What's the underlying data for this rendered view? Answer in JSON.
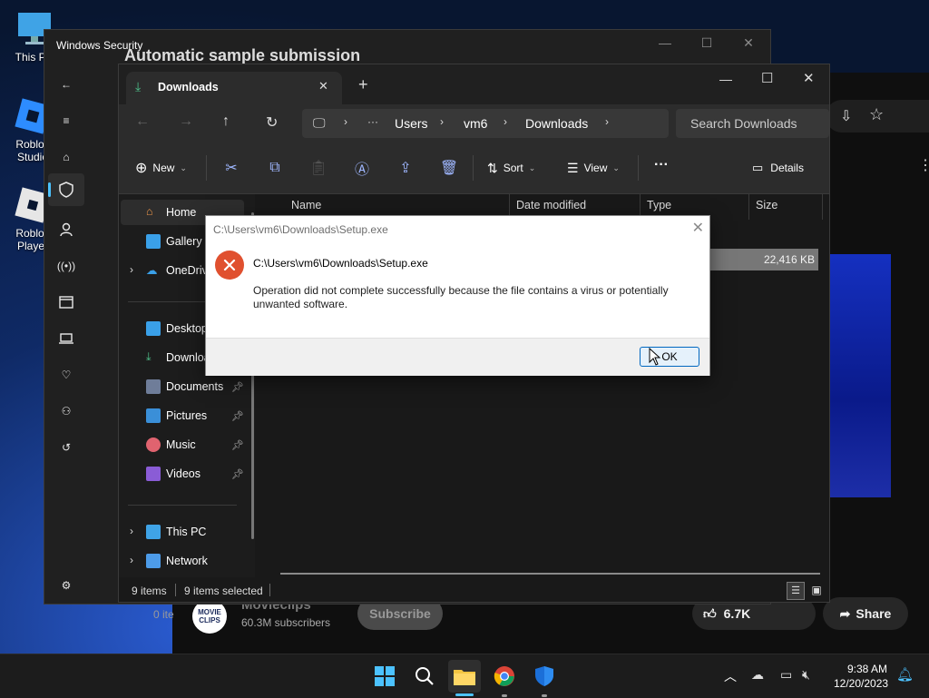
{
  "desktop": {
    "icons": [
      {
        "label": "This PC"
      },
      {
        "label": "Roblox Studio"
      },
      {
        "label": "Roblox Player"
      }
    ]
  },
  "background_browser": {
    "title_partial": "Automatic sample submission",
    "channel": "Movieclips",
    "subscribers": "60.3M subscribers",
    "subscribe_label": "Subscribe",
    "likes": "6.7K",
    "share_label": "Share",
    "items_partial": "0 ite"
  },
  "windows_security": {
    "title": "Windows Security",
    "controls": {
      "minimize": "—",
      "maximize": "☐",
      "close": "✕"
    }
  },
  "explorer": {
    "tab_label": "Downloads",
    "tab_close": "✕",
    "new_tab": "+",
    "window_controls": {
      "minimize": "—",
      "maximize": "☐",
      "close": "✕"
    },
    "breadcrumb": [
      "Users",
      "vm6",
      "Downloads"
    ],
    "breadcrumb_more": "···",
    "search_placeholder": "Search Downloads",
    "toolbar": {
      "new_label": "New",
      "sort_label": "Sort",
      "view_label": "View",
      "more_label": "···",
      "details_label": "Details"
    },
    "sidebar": {
      "home": "Home",
      "gallery": "Gallery",
      "onedrive": "OneDrive",
      "pinned": [
        "Desktop",
        "Downloads",
        "Documents",
        "Pictures",
        "Music",
        "Videos"
      ],
      "this_pc": "This PC",
      "network": "Network"
    },
    "columns": [
      "Name",
      "Date modified",
      "Type",
      "Size"
    ],
    "rows": [
      {
        "size": "22,416 KB"
      }
    ],
    "status": {
      "count": "9 items",
      "selected": "9 items selected"
    }
  },
  "dialog": {
    "title": "C:\\Users\\vm6\\Downloads\\Setup.exe",
    "heading": "C:\\Users\\vm6\\Downloads\\Setup.exe",
    "message": "Operation did not complete successfully because the file contains a virus or potentially unwanted software.",
    "ok_label": "OK",
    "close": "✕"
  },
  "taskbar": {
    "time": "9:38 AM",
    "date": "12/20/2023",
    "apps": [
      "start-icon",
      "search-icon",
      "file-explorer-icon",
      "chrome-icon",
      "windows-security-icon"
    ]
  },
  "colors": {
    "accent": "#0067c0",
    "error": "#e0502f",
    "explorer_bg": "#191919",
    "toolbar_bg": "#2c2c2c"
  }
}
